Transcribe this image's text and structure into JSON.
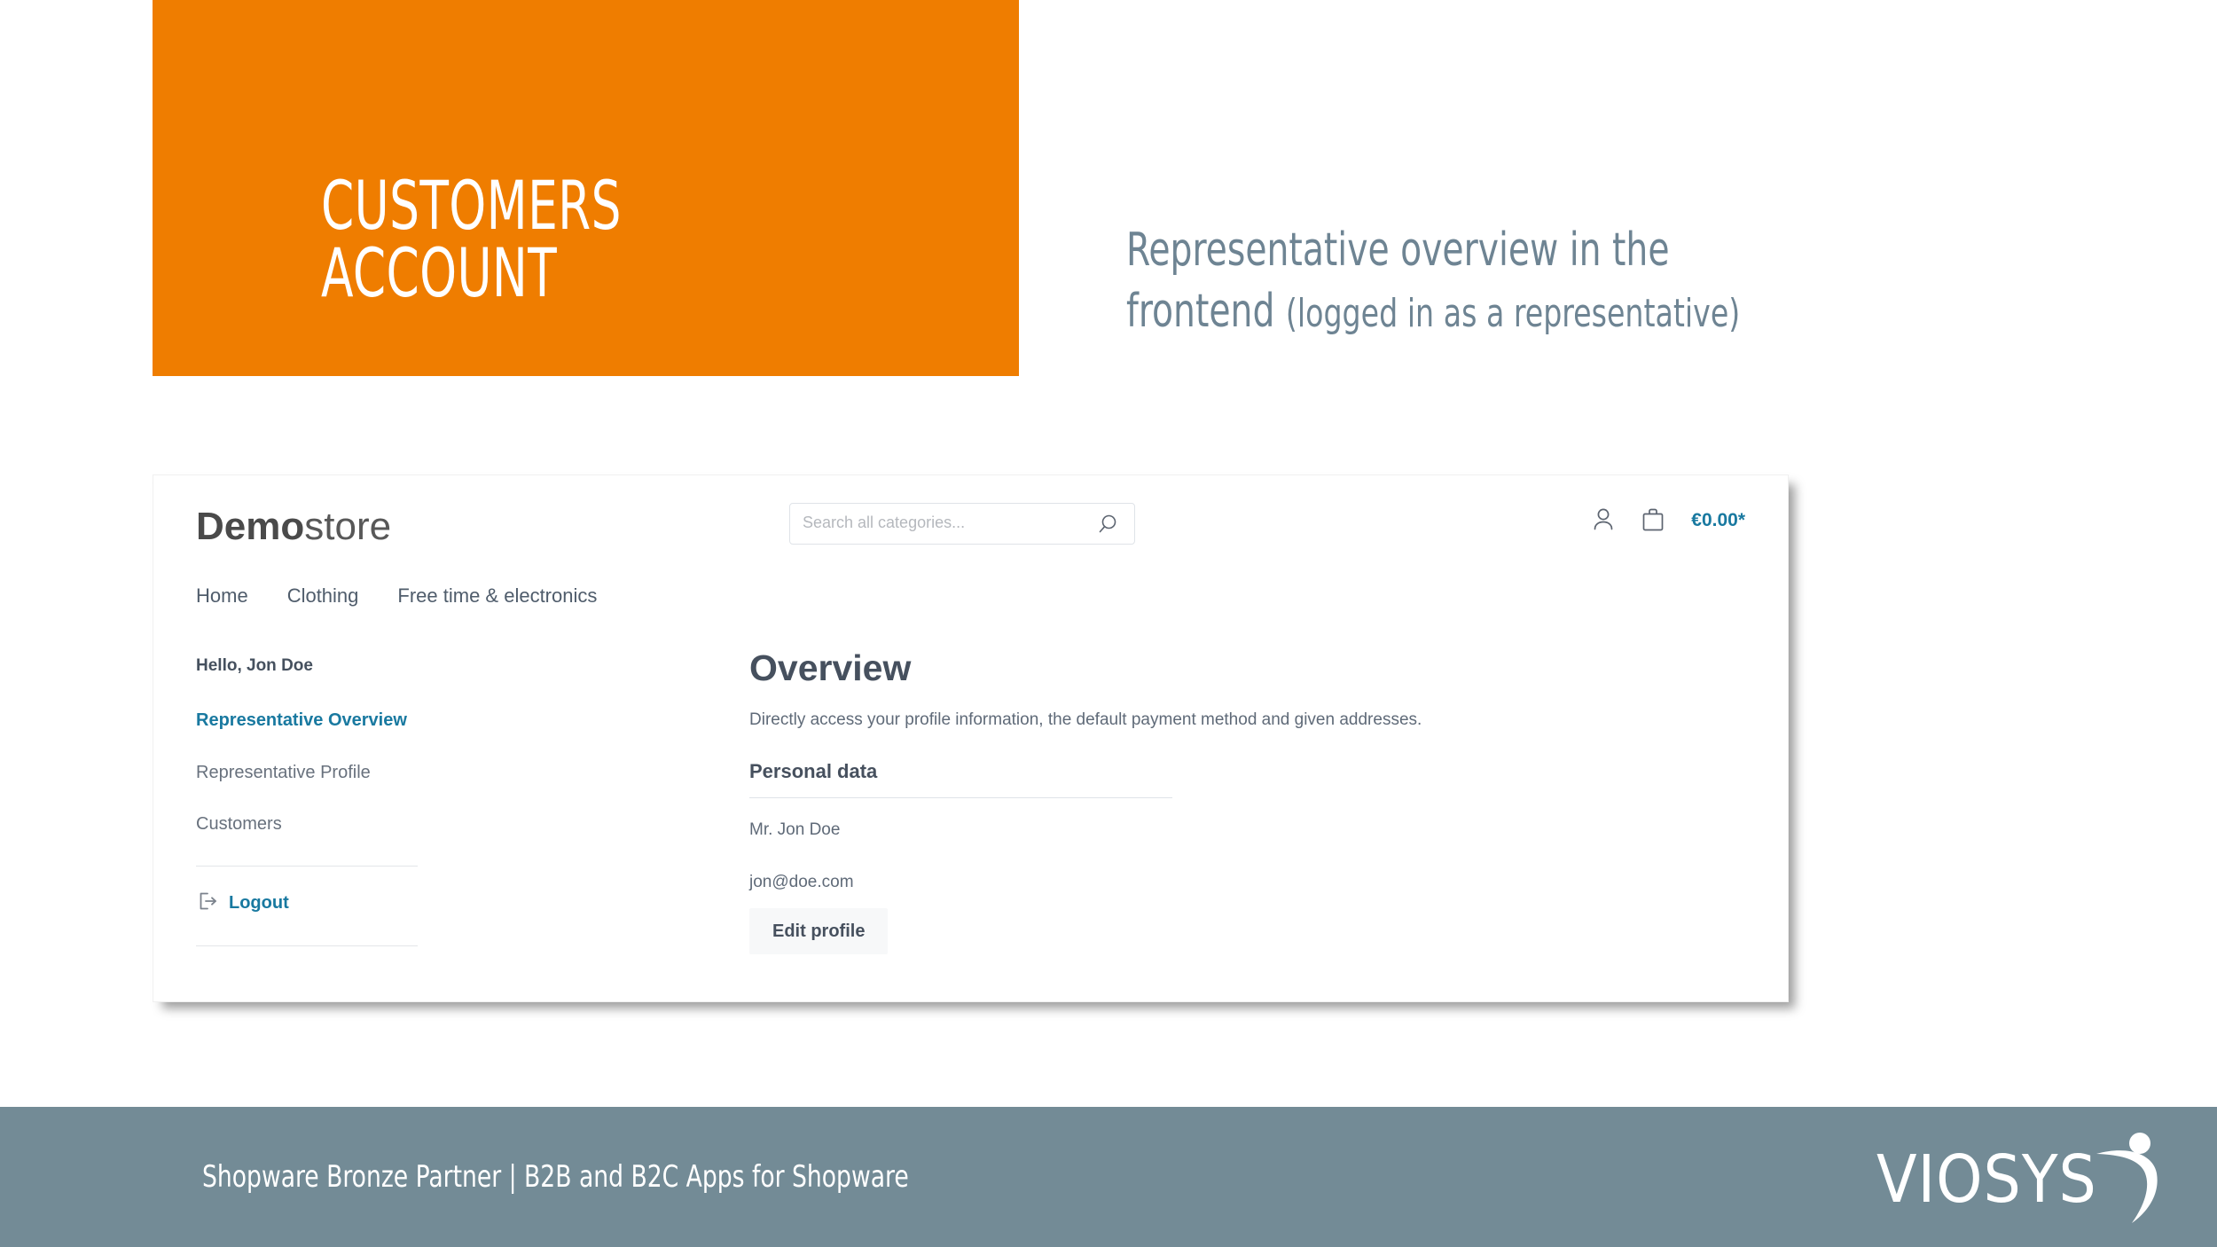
{
  "slide": {
    "title_block": "CUSTOMERS\nACCOUNT",
    "heading_main": "Representative overview in the",
    "heading_line2": "frontend ",
    "heading_note": "(logged in as a representative)"
  },
  "colors": {
    "orange": "#EF7D00",
    "slate": "#6E8493",
    "footer_bar": "#738B96",
    "teal_accent": "#1979A0",
    "text_dark": "#46505E"
  },
  "store": {
    "logo_bold": "Demo",
    "logo_light": "store",
    "search": {
      "placeholder": "Search all categories...",
      "value": "",
      "icon": "search-icon"
    },
    "account_icon": "user-icon",
    "cart_icon": "shopping-bag-icon",
    "cart_total": "€0.00*",
    "nav": [
      {
        "label": "Home"
      },
      {
        "label": "Clothing"
      },
      {
        "label": "Free time & electronics"
      }
    ],
    "sidebar": {
      "greeting": "Hello, Jon Doe",
      "items": [
        {
          "label": "Representative Overview",
          "active": true
        },
        {
          "label": "Representative Profile",
          "active": false
        },
        {
          "label": "Customers",
          "active": false
        }
      ],
      "logout": {
        "label": "Logout",
        "icon": "logout-icon"
      }
    },
    "main": {
      "title": "Overview",
      "description": "Directly access your profile information, the default payment method and given addresses.",
      "personal_data": {
        "section_title": "Personal data",
        "name": "Mr. Jon Doe",
        "email": "jon@doe.com",
        "edit_button": "Edit profile"
      }
    }
  },
  "footer": {
    "text": "Shopware Bronze Partner  |  B2B and B2C Apps for Shopware",
    "logo_text": "VIOSYS",
    "logo_icon": "viosys-swoosh-icon"
  }
}
